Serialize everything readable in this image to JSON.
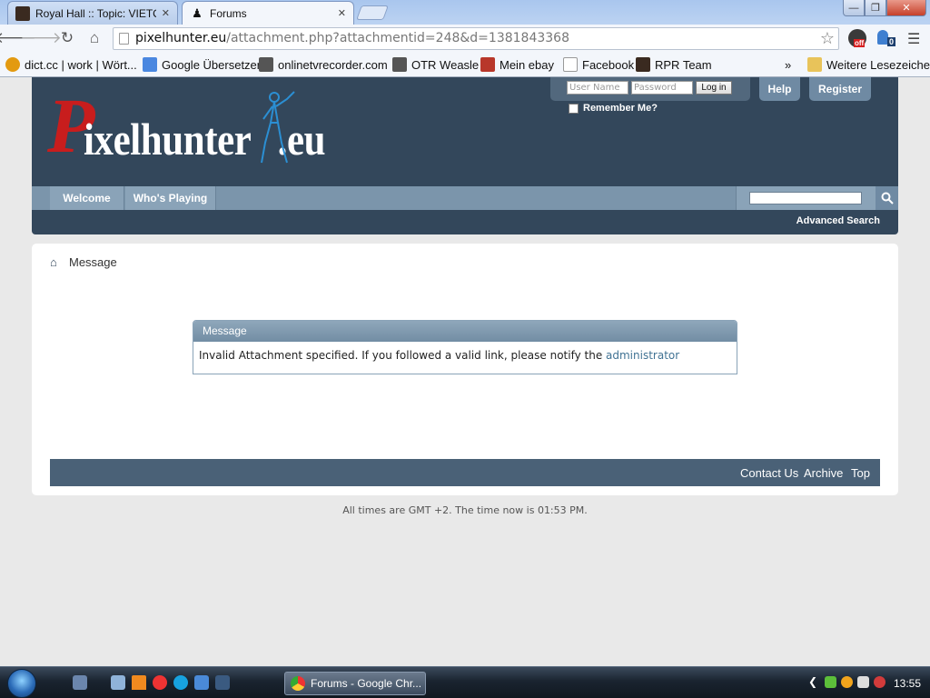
{
  "browser": {
    "tabs": [
      {
        "title": "Royal Hall :: Topic: VIETCO",
        "active": false
      },
      {
        "title": "Forums",
        "active": true
      }
    ],
    "address": {
      "domain": "pixelhunter.eu",
      "path": "/attachment.php?attachmentid=248&d=1381843368"
    },
    "extension_badges": {
      "first": "off",
      "second": "0"
    },
    "bookmarks": [
      "dict.cc | work | Wört...",
      "Google Übersetzer",
      "onlinetvrecorder.com",
      "OTR Weasle",
      "Mein ebay",
      "Facebook",
      "RPR Team"
    ],
    "bookmarks_overflow": "»",
    "other_bookmarks": "Weitere Lesezeichen"
  },
  "site": {
    "logo": {
      "letter": "P",
      "rest": "ixelhunter",
      "suffix": ".eu"
    },
    "login": {
      "username_placeholder": "User Name",
      "password_placeholder": "Password",
      "login_label": "Log in",
      "remember_label": "Remember Me?"
    },
    "header_buttons": {
      "help": "Help",
      "register": "Register"
    },
    "nav": {
      "welcome": "Welcome",
      "whos_playing": "Who's Playing"
    },
    "advanced_search": "Advanced Search",
    "breadcrumb": "Message",
    "message": {
      "title": "Message",
      "text": "Invalid Attachment specified. If you followed a valid link, please notify the ",
      "link": "administrator"
    },
    "footer": {
      "contact": "Contact Us",
      "archive": "Archive",
      "top": "Top"
    },
    "timezone_note": "All times are GMT +2. The time now is 01:53 PM."
  },
  "taskbar": {
    "active_window": "Forums - Google Chr...",
    "clock": "13:55"
  },
  "colors": {
    "header_bg": "#33475b",
    "nav_bg": "#7b95ab",
    "logo_red": "#c81d1d",
    "link": "#417394"
  }
}
